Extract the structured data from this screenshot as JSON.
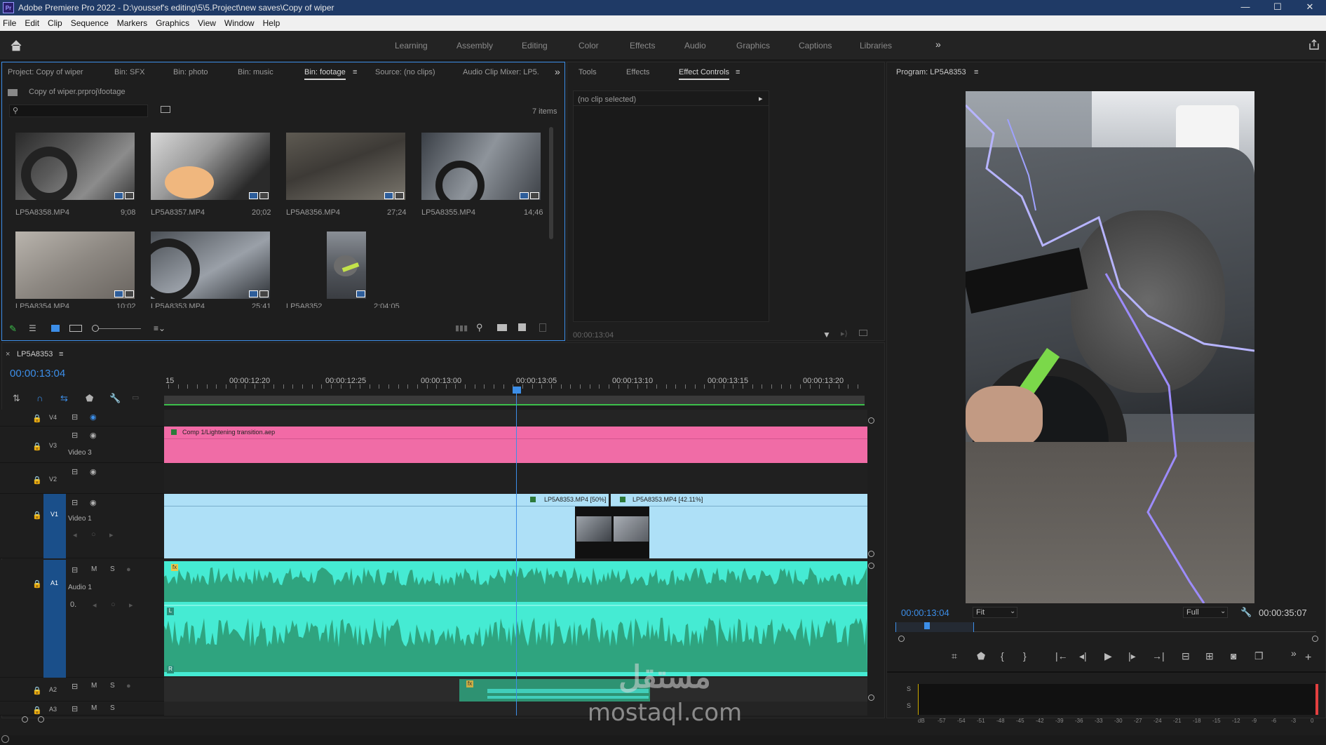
{
  "window": {
    "title": "Adobe Premiere Pro 2022 - D:\\youssef's editing\\5\\5.Project\\new saves\\Copy of wiper",
    "logo": "Pr",
    "controls": [
      "—",
      "☐",
      "✕"
    ]
  },
  "menu": [
    "File",
    "Edit",
    "Clip",
    "Sequence",
    "Markers",
    "Graphics",
    "View",
    "Window",
    "Help"
  ],
  "workspaces": [
    "Learning",
    "Assembly",
    "Editing",
    "Color",
    "Effects",
    "Audio",
    "Graphics",
    "Captions",
    "Libraries"
  ],
  "project_panel": {
    "tabs": [
      "Project: Copy of wiper",
      "Bin: SFX",
      "Bin: photo",
      "Bin: music",
      "Bin: footage",
      "Source: (no clips)",
      "Audio Clip Mixer: LP5."
    ],
    "active_tab": "Bin: footage",
    "path": "Copy of wiper.prproj\\footage",
    "count": "7 items",
    "clips": [
      {
        "name": "LP5A8358.MP4",
        "dur": "9;08"
      },
      {
        "name": "LP5A8357.MP4",
        "dur": "20;02"
      },
      {
        "name": "LP5A8356.MP4",
        "dur": "27;24"
      },
      {
        "name": "LP5A8355.MP4",
        "dur": "14;46"
      },
      {
        "name": "LP5A8354.MP4",
        "dur": "10;02"
      },
      {
        "name": "LP5A8353.MP4",
        "dur": "25;41"
      },
      {
        "name": "LP5A8352",
        "dur": "2;04;05"
      }
    ]
  },
  "effects_panel": {
    "tabs": [
      "Tools",
      "Effects",
      "Effect Controls"
    ],
    "active_tab": "Effect Controls",
    "status": "(no clip selected)",
    "timecode": "00:00:13:04"
  },
  "program_monitor": {
    "title": "Program: LP5A8353",
    "timecode": "00:00:13:04",
    "fit": "Fit",
    "quality": "Full",
    "duration": "00:00:35:07"
  },
  "timeline": {
    "sequence": "LP5A8353",
    "timecode": "00:00:13:04",
    "ruler": [
      "15",
      "00:00:12:20",
      "00:00:12:25",
      "00:00:13:00",
      "00:00:13:05",
      "00:00:13:10",
      "00:00:13:15",
      "00:00:13:20"
    ],
    "tracks": [
      {
        "id": "V4",
        "name": ""
      },
      {
        "id": "V3",
        "name": "Video 3"
      },
      {
        "id": "V2",
        "name": ""
      },
      {
        "id": "V1",
        "name": "Video 1"
      },
      {
        "id": "A1",
        "name": "Audio 1"
      },
      {
        "id": "A2",
        "name": ""
      },
      {
        "id": "A3",
        "name": ""
      }
    ],
    "clips": {
      "comp": "Comp 1/Lightening transition.aep",
      "v1a": "LP5A8353.MP4 [50%]",
      "v1b": "LP5A8353.MP4 [42.11%]"
    },
    "channel_labels": [
      "L",
      "R"
    ],
    "fx": "fx",
    "ms": [
      "M",
      "S"
    ],
    "a1_value": "0."
  },
  "meter": {
    "scale": [
      "dB",
      "-57",
      "-54",
      "-51",
      "-48",
      "-45",
      "-42",
      "-39",
      "-36",
      "-33",
      "-30",
      "-27",
      "-24",
      "-21",
      "-18",
      "-15",
      "-12",
      "-9",
      "-6",
      "-3",
      "0"
    ],
    "labels": [
      "S",
      "S"
    ]
  },
  "watermark": {
    "text": "mostaql.com"
  },
  "colors": {
    "accent": "#3c8ee8",
    "comp_clip": "#f06ca6",
    "video_clip": "#aee0f7",
    "audio_clip": "#45ebd3",
    "track_select": "#1a4f8a"
  }
}
